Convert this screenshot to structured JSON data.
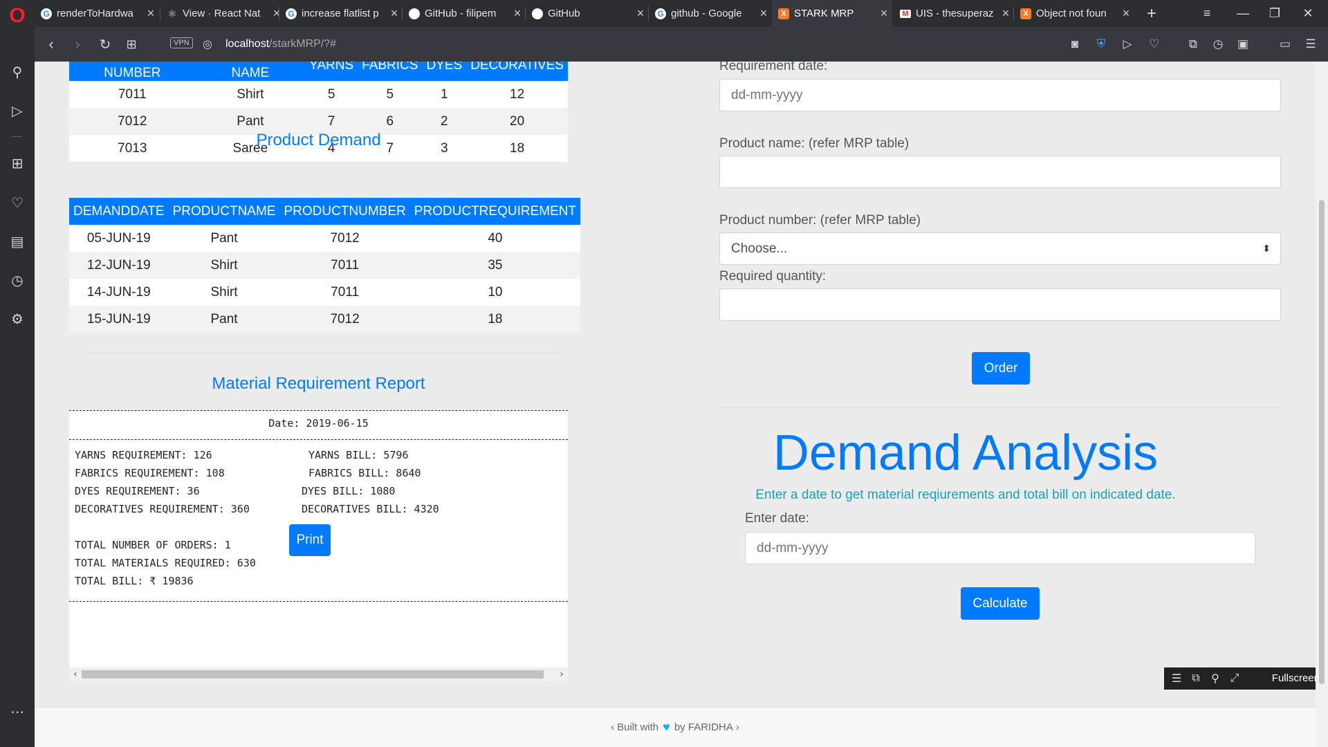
{
  "browser": {
    "tabs": [
      {
        "title": "renderToHardwa",
        "icon": "google-icon"
      },
      {
        "title": "View · React Nat",
        "icon": "react-icon"
      },
      {
        "title": "increase flatlist p",
        "icon": "google-icon"
      },
      {
        "title": "GitHub - filipem",
        "icon": "github-icon"
      },
      {
        "title": "GitHub",
        "icon": "github-icon"
      },
      {
        "title": "github - Google",
        "icon": "google-icon"
      },
      {
        "title": "STARK MRP",
        "icon": "xampp-icon"
      },
      {
        "title": "UIS - thesuperaz",
        "icon": "gmail-icon"
      },
      {
        "title": "Object not foun",
        "icon": "xampp-icon"
      }
    ],
    "active_tab": 6,
    "url_host": "localhost",
    "url_path": "/starkMRP/?#",
    "vpn_label": "VPN"
  },
  "mrp_table": {
    "headers": [
      "PRODUCT NUMBER",
      "PRODUCT NAME",
      "YARNS",
      "FABRICS",
      "DYES",
      "DECORATIVES"
    ],
    "rows": [
      [
        "7011",
        "Shirt",
        "5",
        "5",
        "1",
        "12"
      ],
      [
        "7012",
        "Pant",
        "7",
        "6",
        "2",
        "20"
      ],
      [
        "7013",
        "Saree",
        "4",
        "7",
        "3",
        "18"
      ]
    ]
  },
  "product_demand": {
    "title": "Product Demand",
    "headers": [
      "DEMANDDATE",
      "PRODUCTNAME",
      "PRODUCTNUMBER",
      "PRODUCTREQUIREMENT"
    ],
    "rows": [
      [
        "05-JUN-19",
        "Pant",
        "7012",
        "40"
      ],
      [
        "12-JUN-19",
        "Shirt",
        "7011",
        "35"
      ],
      [
        "14-JUN-19",
        "Shirt",
        "7011",
        "10"
      ],
      [
        "15-JUN-19",
        "Pant",
        "7012",
        "18"
      ]
    ]
  },
  "report": {
    "title": "Material Requirement Report",
    "date_line": "Date: 2019-06-15",
    "left_lines": [
      "YARNS REQUIREMENT: 126",
      "FABRICS REQUIREMENT: 108",
      "DYES REQUIREMENT: 36",
      "DECORATIVES REQUIREMENT: 360"
    ],
    "right_lines": [
      "YARNS BILL: 5796",
      "FABRICS BILL: 8640",
      "DYES BILL: 1080",
      "DECORATIVES BILL: 4320"
    ],
    "totals": [
      "TOTAL NUMBER OF ORDERS: 1",
      "TOTAL MATERIALS REQUIRED: 630",
      "TOTAL BILL: ₹ 19836"
    ],
    "print_label": "Print"
  },
  "order_form": {
    "requirement_date_label": "Requirement date:",
    "requirement_date_placeholder": "dd-mm-yyyy",
    "product_name_label": "Product name: (refer MRP table)",
    "product_name_value": "",
    "product_number_label": "Product number: (refer MRP table)",
    "product_number_selected": "Choose...",
    "quantity_label": "Required quantity:",
    "quantity_value": "",
    "order_label": "Order"
  },
  "demand_analysis": {
    "heading": "Demand Analysis",
    "subtitle": "Enter a date to get material reqiurements and total bill on indicated date.",
    "date_label": "Enter date:",
    "date_placeholder": "dd-mm-yyyy",
    "calculate_label": "Calculate"
  },
  "fullscreen_bar": {
    "label": "Fullscreen"
  },
  "footer": {
    "built_with": "Built with",
    "by": "by FARIDHA",
    "left_chevron": "‹",
    "right_chevron": "›"
  },
  "colors": {
    "primary": "#007bff",
    "info": "#17a2b8",
    "opera_red": "#ff1b2d"
  }
}
